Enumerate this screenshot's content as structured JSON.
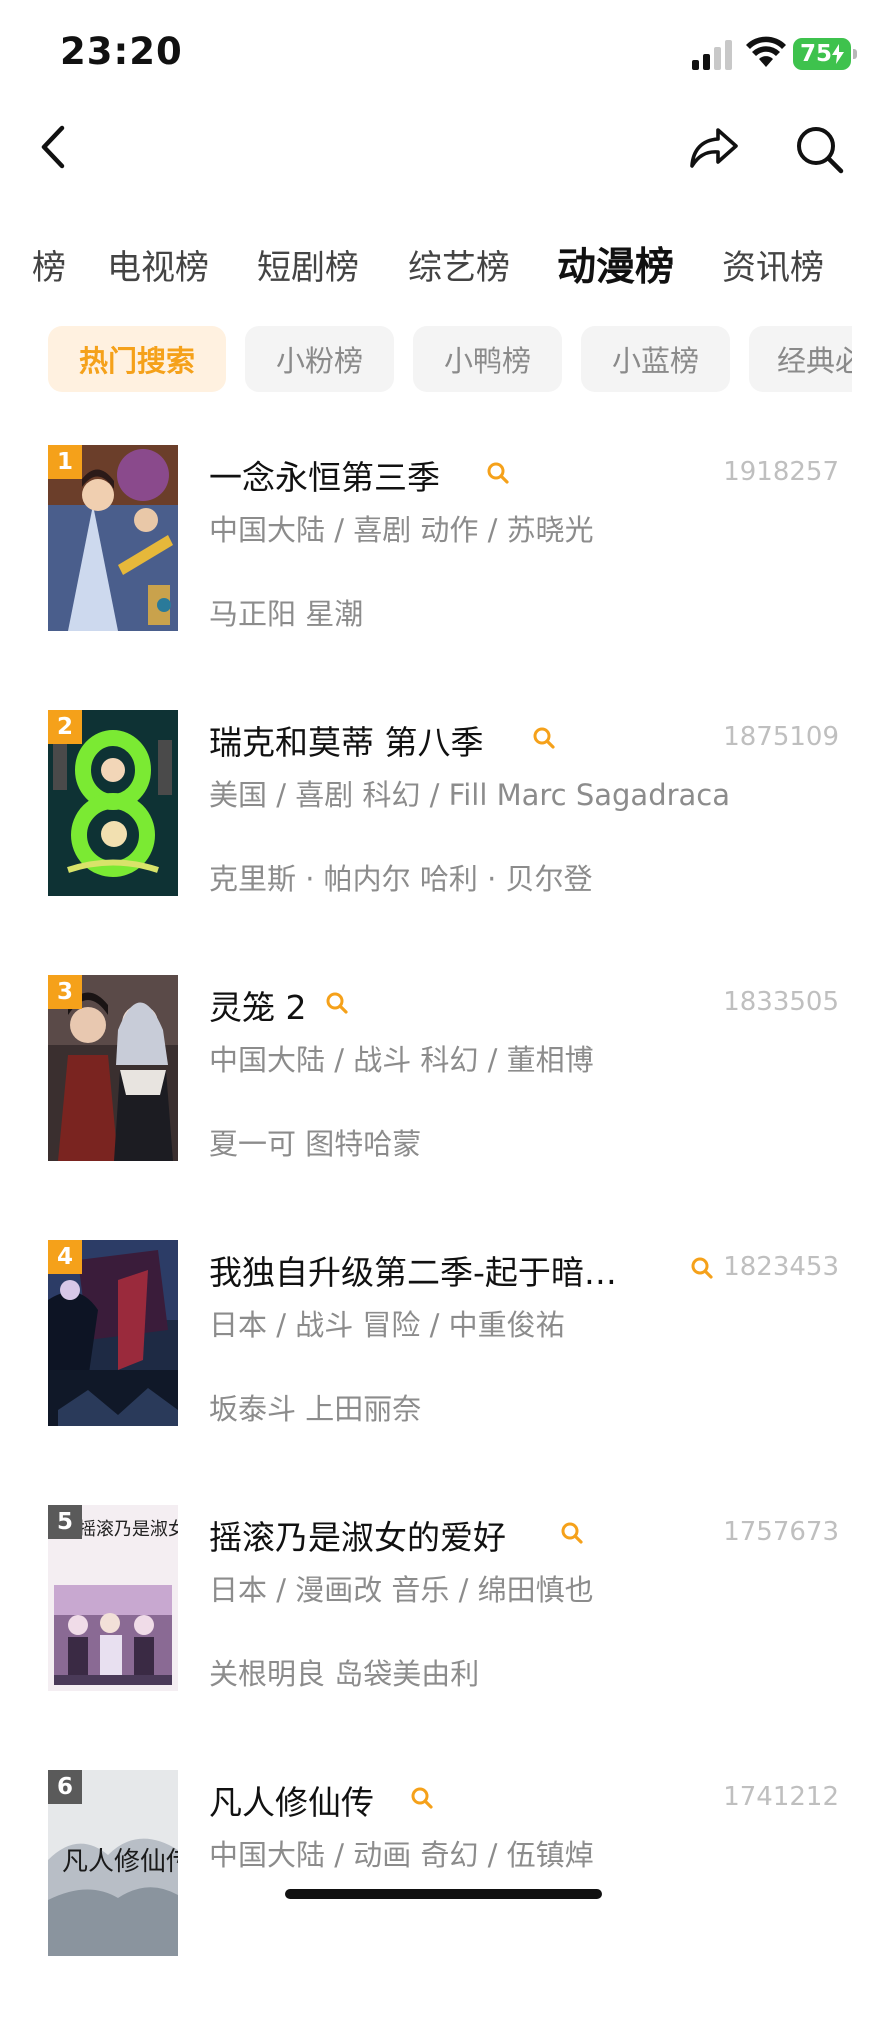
{
  "status": {
    "time": "23:20",
    "battery": "75"
  },
  "tabs": [
    "榜",
    "电视榜",
    "短剧榜",
    "综艺榜",
    "动漫榜",
    "资讯榜"
  ],
  "active_tab": "动漫榜",
  "chips": [
    "热门搜索",
    "小粉榜",
    "小鸭榜",
    "小蓝榜",
    "经典必"
  ],
  "active_chip": "热门搜索",
  "items": [
    {
      "rank": "1",
      "title": "一念永恒第三季",
      "count": "1918257",
      "info": "中国大陆 / 喜剧 动作 / 苏晓光",
      "cast": "马正阳 星潮",
      "badge_color": "#f5a11a"
    },
    {
      "rank": "2",
      "title": "瑞克和莫蒂 第八季",
      "count": "1875109",
      "info": "美国 / 喜剧 科幻 / Fill Marc Sagadraca",
      "cast": "克里斯 · 帕内尔 哈利 · 贝尔登",
      "badge_color": "#f5a11a"
    },
    {
      "rank": "3",
      "title": "灵笼 2",
      "count": "1833505",
      "info": "中国大陆 / 战斗 科幻 / 董相博",
      "cast": "夏一可 图特哈蒙",
      "badge_color": "#f5a11a"
    },
    {
      "rank": "4",
      "title": "我独自升级第二季-起于暗…",
      "count": "1823453",
      "info": "日本 / 战斗 冒险 / 中重俊祐",
      "cast": "坂泰斗 上田丽奈",
      "badge_color": "#f5a11a"
    },
    {
      "rank": "5",
      "title": "摇滚乃是淑女的爱好",
      "count": "1757673",
      "info": "日本 / 漫画改 音乐 / 绵田慎也",
      "cast": "关根明良 岛袋美由利",
      "badge_color": "#5a5a5a"
    },
    {
      "rank": "6",
      "title": "凡人修仙传",
      "count": "1741212",
      "info": "中国大陆 / 动画 奇幻 / 伍镇焯",
      "cast": "",
      "badge_color": "#5a5a5a"
    }
  ],
  "poster5_text": "摇滚乃是淑女的爱好",
  "poster6_text": "凡人修仙传",
  "colors": {
    "accent": "#f5a11a",
    "chip_active_bg": "#fff1e0"
  }
}
